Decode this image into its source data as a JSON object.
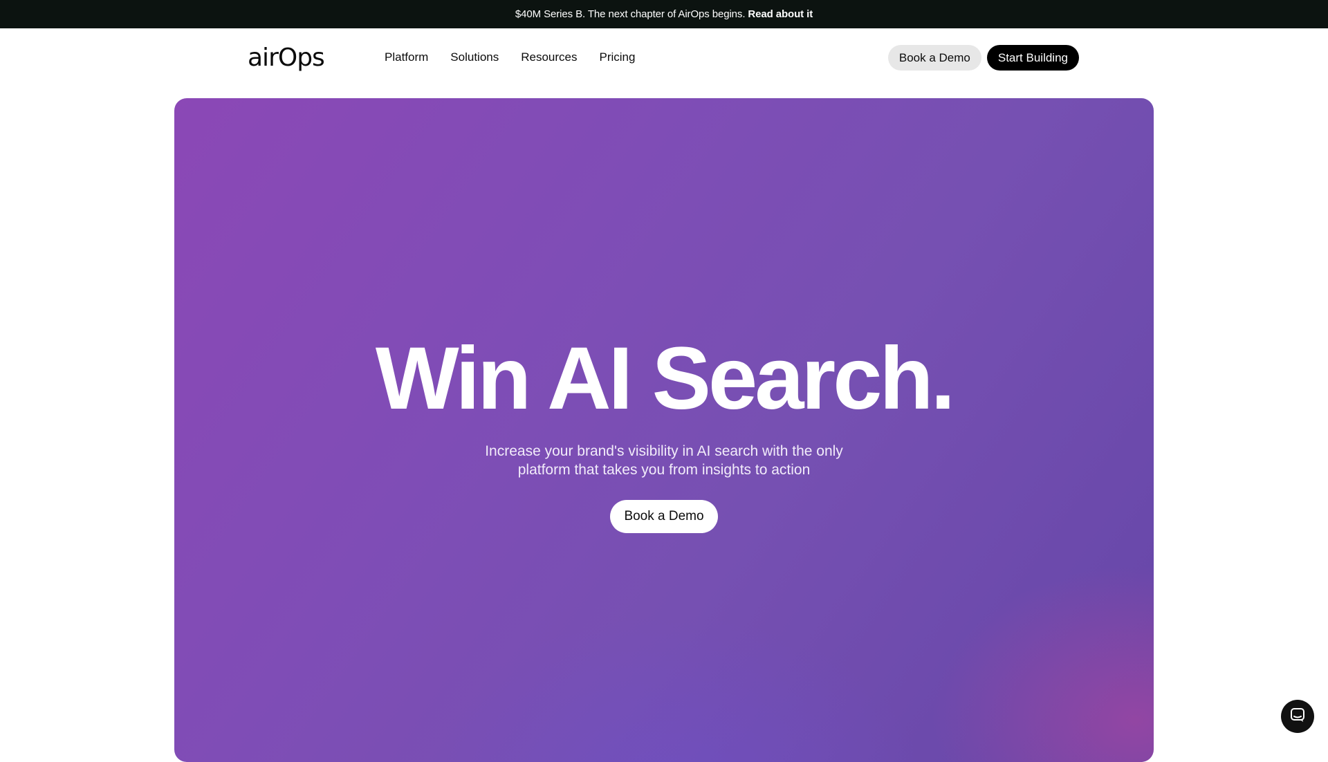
{
  "announcement": {
    "message": "$40M Series B. The next chapter of AirOps begins.",
    "link_label": "Read about it"
  },
  "header": {
    "logo_text": "airOps",
    "nav": [
      {
        "label": "Platform"
      },
      {
        "label": "Solutions"
      },
      {
        "label": "Resources"
      },
      {
        "label": "Pricing"
      }
    ],
    "book_demo_label": "Book a Demo",
    "start_building_label": "Start Building"
  },
  "hero": {
    "title": "Win AI Search.",
    "subtitle_line1": "Increase your brand's visibility in AI search with the only",
    "subtitle_line2": "platform that takes you from insights to action",
    "cta_label": "Book a Demo"
  },
  "chat": {
    "icon": "chat-icon"
  },
  "colors": {
    "announcement_bg": "#0c1310",
    "hero_gradient_start": "#8b48b6",
    "hero_gradient_end": "#6546a8",
    "primary_button": "#000000",
    "secondary_button": "#e7e7e7"
  }
}
